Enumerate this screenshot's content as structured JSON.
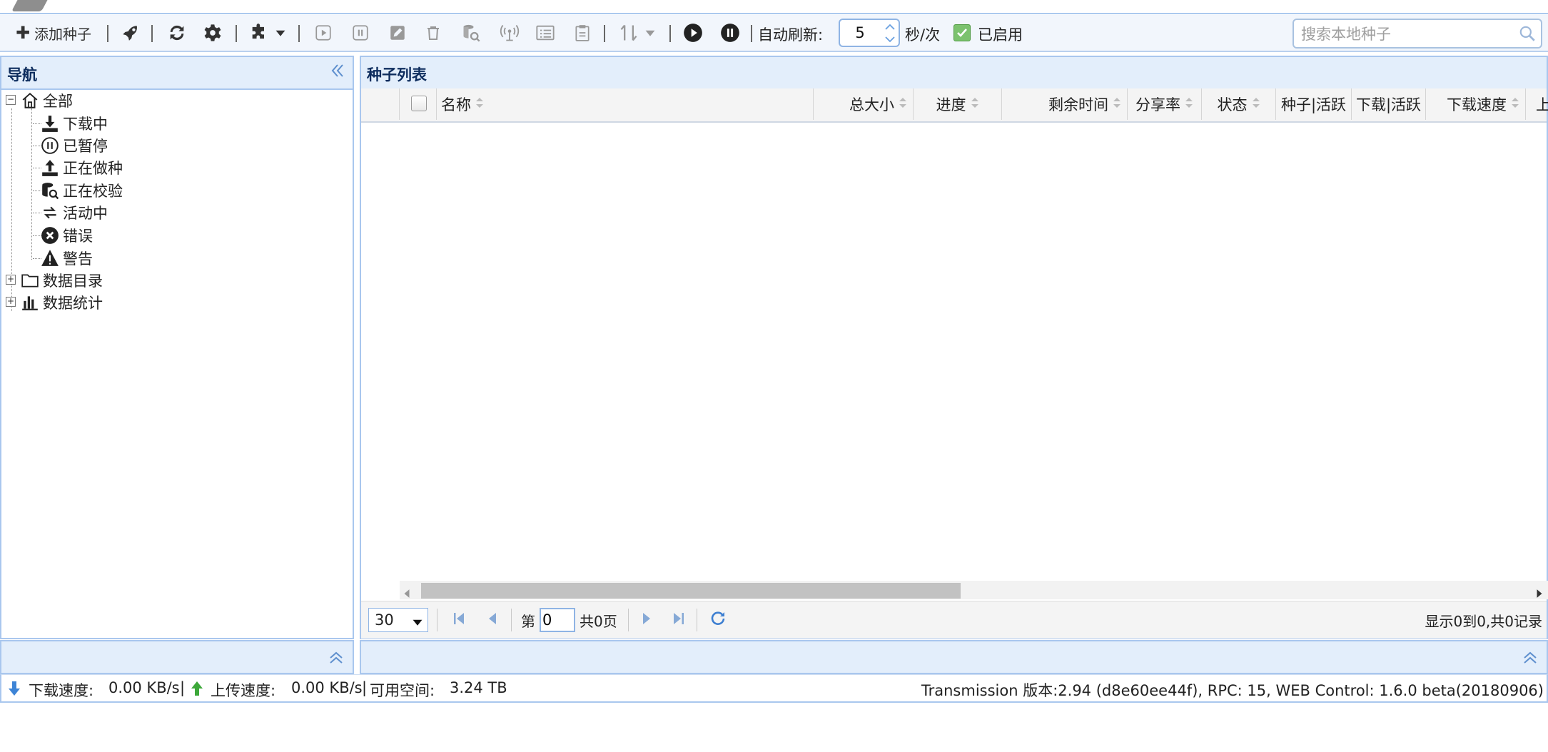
{
  "toolbar": {
    "add_torrent_label": "添加种子",
    "auto_refresh_label": "自动刷新:",
    "refresh_interval": "5",
    "refresh_unit": "秒/次",
    "enabled_label": "已启用",
    "search_placeholder": "搜索本地种子"
  },
  "nav": {
    "title": "导航",
    "items": [
      {
        "label": "全部",
        "icon": "home-icon"
      },
      {
        "label": "下载中",
        "icon": "download-icon"
      },
      {
        "label": "已暂停",
        "icon": "pause-circle-icon"
      },
      {
        "label": "正在做种",
        "icon": "upload-icon"
      },
      {
        "label": "正在校验",
        "icon": "database-check-icon"
      },
      {
        "label": "活动中",
        "icon": "exchange-icon"
      },
      {
        "label": "错误",
        "icon": "error-icon"
      },
      {
        "label": "警告",
        "icon": "warning-icon"
      },
      {
        "label": "数据目录",
        "icon": "folder-icon"
      },
      {
        "label": "数据统计",
        "icon": "bar-chart-icon"
      }
    ]
  },
  "list": {
    "title": "种子列表",
    "columns": [
      "名称",
      "总大小",
      "进度",
      "剩余时间",
      "分享率",
      "状态",
      "种子|活跃",
      "下载|活跃",
      "下载速度",
      "上"
    ]
  },
  "pager": {
    "page_size": "30",
    "page_prefix": "第",
    "current_page": "0",
    "total_pages": "共0页",
    "record_info": "显示0到0,共0记录"
  },
  "status": {
    "download_label": "下载速度:",
    "download_value": "0.00 KB/s",
    "upload_label": "上传速度:",
    "upload_value": "0.00 KB/s",
    "space_label": "可用空间:",
    "space_value": "3.24 TB",
    "version_text": "Transmission 版本:2.94 (d8e60ee44f), RPC: 15, WEB Control: 1.6.0 beta(20180906)"
  },
  "colors": {
    "accent": "#a9c7ee",
    "panel_header": "#e3eefb",
    "title_text": "#0e2d5e"
  }
}
